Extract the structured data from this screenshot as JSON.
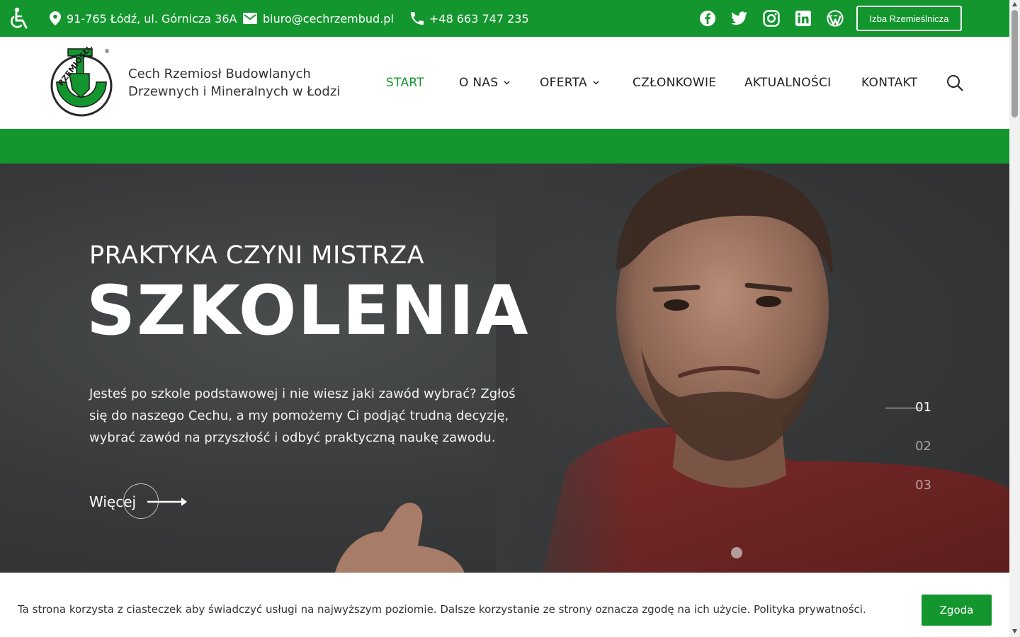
{
  "colors": {
    "brand_green": "#14962f",
    "hero_dark": "#383a3b"
  },
  "topbar": {
    "address": "91-765 Łódź, ul. Górnicza 36A",
    "email": "biuro@cechrzembud.pl",
    "phone": "+48 663 747 235",
    "social_icons": [
      "facebook-icon",
      "twitter-icon",
      "instagram-icon",
      "linkedin-icon",
      "wordpress-icon"
    ],
    "izba_label": "Izba Rzemieślnicza"
  },
  "header": {
    "brand_line1": "Cech Rzemiosł Budowlanych",
    "brand_line2": "Drzewnych i Mineralnych w Łodzi",
    "logo_text": "RZEMIOSŁO",
    "nav": [
      {
        "label": "START",
        "active": true
      },
      {
        "label": "O NAS",
        "dropdown": true
      },
      {
        "label": "OFERTA",
        "dropdown": true
      },
      {
        "label": "CZŁONKOWIE"
      },
      {
        "label": "AKTUALNOŚCI"
      },
      {
        "label": "KONTAKT"
      }
    ]
  },
  "hero": {
    "kicker": "PRAKTYKA CZYNI MISTRZA",
    "headline": "SZKOLENIA",
    "lead": "Jesteś po szkole podstawowej i nie wiesz jaki zawód wybrać? Zgłoś się do naszego Cechu, a my pomożemy Ci podjąć trudną decyzję, wybrać zawód na przyszłość i odbyć praktyczną naukę zawodu.",
    "more_label": "Więcej",
    "slides": [
      "01",
      "02",
      "03"
    ],
    "active_slide": 0
  },
  "cookie": {
    "text": "Ta strona korzysta z ciasteczek aby świadczyć usługi na najwyższym poziomie. Dalsze korzystanie ze strony oznacza zgodę na ich użycie. Polityka prywatności.",
    "accept_label": "Zgoda"
  }
}
